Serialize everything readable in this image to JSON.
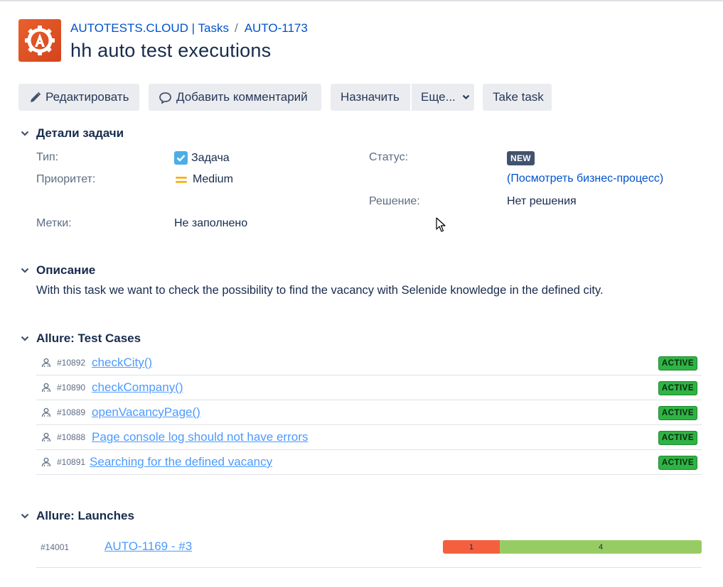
{
  "header": {
    "breadcrumb_project": "AUTOTESTS.CLOUD | Tasks",
    "breadcrumb_separator": "/",
    "breadcrumb_issue_key": "AUTO-1173",
    "title": "hh auto test executions",
    "avatar_icon": "gear-a-logo"
  },
  "toolbar": {
    "edit_label": "Редактировать",
    "comment_label": "Добавить комментарий",
    "assign_label": "Назначить",
    "more_label": "Еще...",
    "take_task_label": "Take task"
  },
  "details": {
    "heading": "Детали задачи",
    "type_label": "Тип:",
    "type_value": "Задача",
    "priority_label": "Приоритет:",
    "priority_value": "Medium",
    "labels_label": "Метки:",
    "labels_value": "Не заполнено",
    "status_label": "Статус:",
    "status_value": "NEW",
    "workflow_link": "(Посмотреть бизнес-процесс)",
    "resolution_label": "Решение:",
    "resolution_value": "Нет решения"
  },
  "description": {
    "heading": "Описание",
    "text": "With this task we want to check the possibility to find the vacancy with Selenide knowledge in the defined city."
  },
  "test_cases": {
    "heading": "Allure: Test Cases",
    "items": [
      {
        "id": "#10892",
        "name": "checkCity()",
        "status": "ACTIVE"
      },
      {
        "id": "#10890",
        "name": "checkCompany()",
        "status": "ACTIVE"
      },
      {
        "id": "#10889",
        "name": "openVacancyPage()",
        "status": "ACTIVE"
      },
      {
        "id": "#10888",
        "name": "Page console log should not have errors",
        "status": "ACTIVE"
      },
      {
        "id": "#10891",
        "name": "Searching for the defined vacancy",
        "status": "ACTIVE"
      }
    ]
  },
  "launches": {
    "heading": "Allure: Launches",
    "items": [
      {
        "id": "#14001",
        "name": "AUTO-1169 - #3",
        "failed": "1",
        "passed": "4",
        "failed_fraction": 0.22
      }
    ]
  },
  "colors": {
    "link": "#0052cc",
    "active_badge": "#2fb344",
    "failed": "#f4603f",
    "passed": "#97cc64",
    "status_new": "#42526e",
    "priority_medium": "#ffab00"
  }
}
